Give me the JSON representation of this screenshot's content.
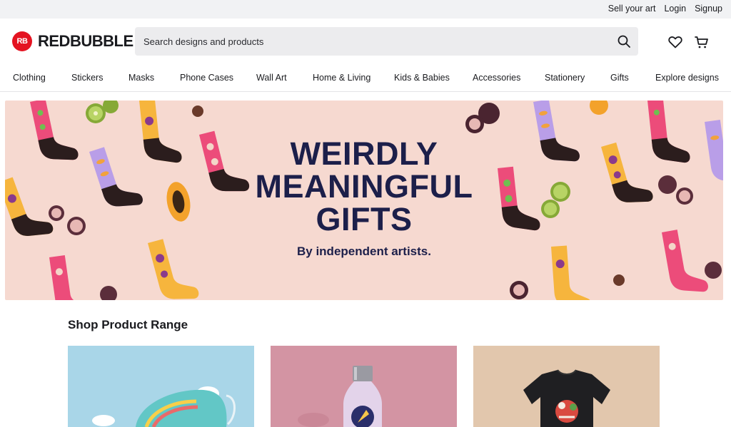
{
  "topbar": {
    "sell": "Sell your art",
    "login": "Login",
    "signup": "Signup"
  },
  "header": {
    "logo_badge": "RB",
    "logo_text": "REDBUBBLE",
    "search_placeholder": "Search designs and products",
    "icons": [
      "search-icon",
      "heart-icon",
      "cart-icon"
    ]
  },
  "nav": {
    "items": [
      "Clothing",
      "Stickers",
      "Masks",
      "Phone Cases",
      "Wall Art",
      "Home & Living",
      "Kids & Babies",
      "Accessories",
      "Stationery",
      "Gifts",
      "Explore designs"
    ]
  },
  "hero": {
    "line1": "WEIRDLY",
    "line2": "MEANINGFUL",
    "line3": "GIFTS",
    "subtitle": "By independent artists."
  },
  "section": {
    "title": "Shop Product Range"
  },
  "colors": {
    "brand": "#e41321",
    "hero_bg": "#f6d9d0",
    "hero_text": "#1c1f4a",
    "card1_bg": "#a9d6e8",
    "card2_bg": "#d394a3",
    "card3_bg": "#e2c7ad"
  }
}
